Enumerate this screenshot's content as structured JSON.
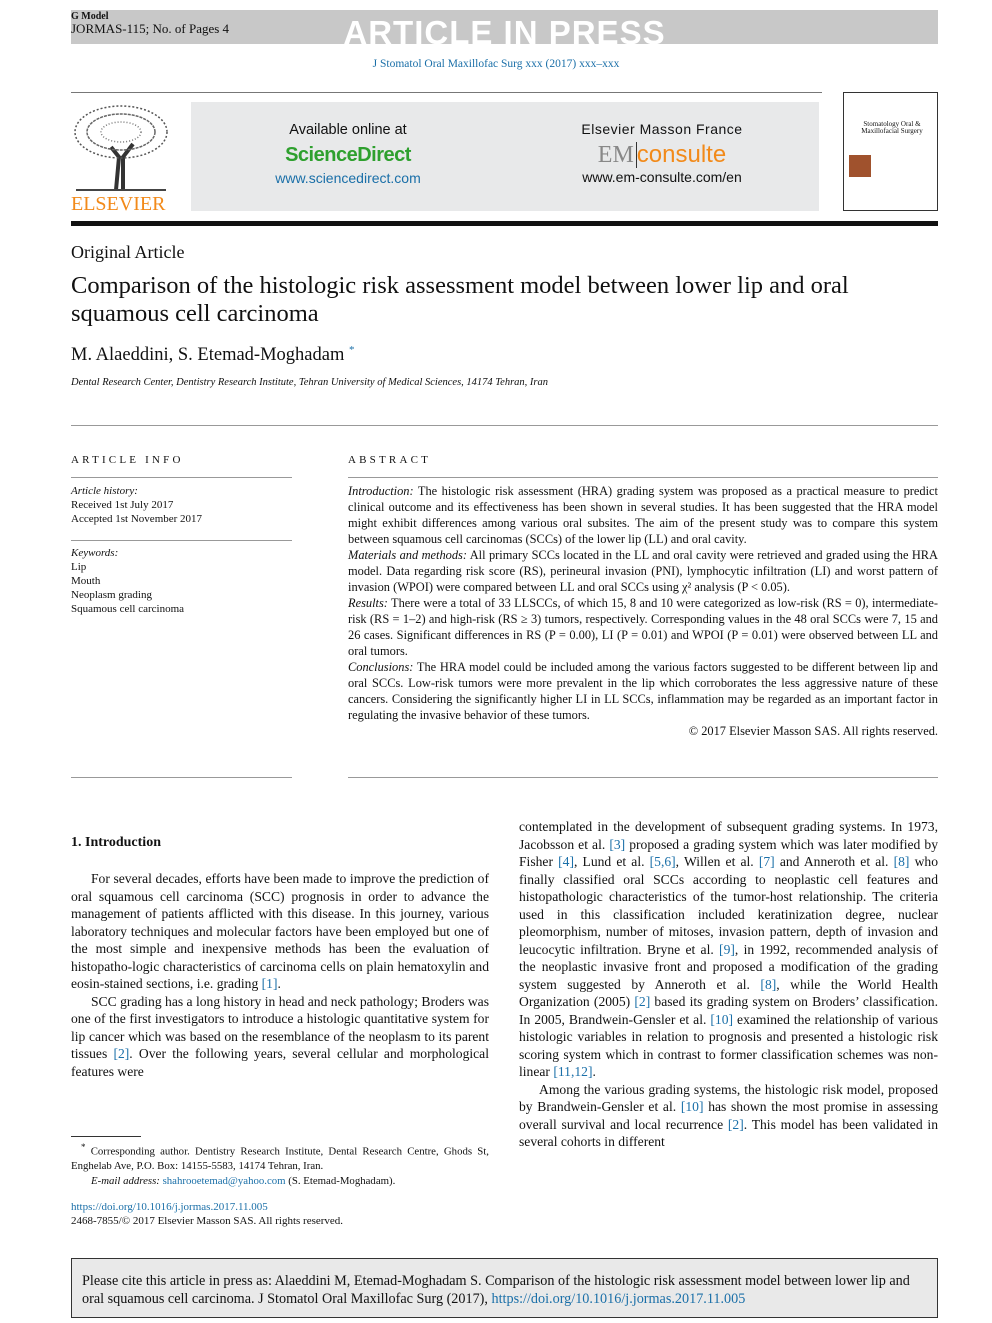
{
  "header": {
    "g_model": "G Model",
    "journal_code": "JORMAS-115; No. of Pages 4",
    "banner": "ARTICLE IN PRESS",
    "journal_ref": "J Stomatol Oral Maxillofac Surg xxx (2017) xxx–xxx"
  },
  "publisher": {
    "logo_text": "ELSEVIER",
    "available": "Available online at",
    "sciencedirect": "ScienceDirect",
    "sd_url": "www.sciencedirect.com",
    "masson": "Elsevier Masson France",
    "em": "EM",
    "consulte": "consulte",
    "em_url": "www.em-consulte.com/en",
    "cover_title": "Stomatology Oral & Maxillofacial Surgery"
  },
  "colors": {
    "link": "#1a6fa8",
    "sciencedirect": "#2ea02e",
    "consulte": "#f28a1a",
    "elsevier": "#f28a1a"
  },
  "article": {
    "type": "Original Article",
    "title": "Comparison of the histologic risk assessment model between lower lip and oral squamous cell carcinoma",
    "authors": "M. Alaeddini, S. Etemad-Moghadam",
    "author_mark": "*",
    "affiliation": "Dental Research Center, Dentistry Research Institute, Tehran University of Medical Sciences, 14174 Tehran, Iran"
  },
  "info": {
    "heading": "ARTICLE INFO",
    "history_label": "Article history:",
    "received": "Received 1st July 2017",
    "accepted": "Accepted 1st November 2017",
    "keywords_label": "Keywords:",
    "keywords": [
      "Lip",
      "Mouth",
      "Neoplasm grading",
      "Squamous cell carcinoma"
    ]
  },
  "abstract": {
    "heading": "ABSTRACT",
    "sections": [
      {
        "label": "Introduction:",
        "text": " The histologic risk assessment (HRA) grading system was proposed as a practical measure to predict clinical outcome and its effectiveness has been shown in several studies. It has been suggested that the HRA model might exhibit differences among various oral subsites. The aim of the present study was to compare this system between squamous cell carcinomas (SCCs) of the lower lip (LL) and oral cavity."
      },
      {
        "label": "Materials and methods:",
        "text": " All primary SCCs located in the LL and oral cavity were retrieved and graded using the HRA model. Data regarding risk score (RS), perineural invasion (PNI), lymphocytic infiltration (LI) and worst pattern of invasion (WPOI) were compared between LL and oral SCCs using χ² analysis (P < 0.05)."
      },
      {
        "label": "Results:",
        "text": " There were a total of 33 LLSCCs, of which 15, 8 and 10 were categorized as low-risk (RS = 0), intermediate-risk (RS = 1–2) and high-risk (RS ≥ 3) tumors, respectively. Corresponding values in the 48 oral SCCs were 7, 15 and 26 cases. Significant differences in RS (P = 0.00), LI (P = 0.01) and WPOI (P = 0.01) were observed between LL and oral tumors."
      },
      {
        "label": "Conclusions:",
        "text": " The HRA model could be included among the various factors suggested to be different between lip and oral SCCs. Low-risk tumors were more prevalent in the lip which corroborates the less aggressive nature of these cancers. Considering the significantly higher LI in LL SCCs, inflammation may be regarded as an important factor in regulating the invasive behavior of these tumors."
      }
    ],
    "copyright": "© 2017 Elsevier Masson SAS. All rights reserved."
  },
  "body": {
    "section_heading": "1.  Introduction",
    "left_paragraphs": [
      [
        [
          "For several decades, efforts have been made to improve the prediction of oral squamous cell carcinoma (SCC) prognosis in order to advance the management of patients afflicted with this disease. In this journey, various laboratory techniques and molecular factors have been employed but one of the most simple and inexpensive methods has been the evaluation of histopatho-logic characteristics of carcinoma cells on plain hematoxylin and eosin-stained sections, i.e. grading ",
          0
        ],
        [
          "[1]",
          1
        ],
        [
          ".",
          0
        ]
      ],
      [
        [
          "SCC grading has a long history in head and neck pathology; Broders was one of the first investigators to introduce a histologic quantitative system for lip cancer which was based on the resemblance of the neoplasm to its parent tissues ",
          0
        ],
        [
          "[2]",
          1
        ],
        [
          ". Over the following years, several cellular and morphological features were",
          0
        ]
      ]
    ],
    "right_paragraphs": [
      [
        [
          "contemplated in the development of subsequent grading systems. In 1973, Jacobsson et al. ",
          0
        ],
        [
          "[3]",
          1
        ],
        [
          " proposed a grading system which was later modified by Fisher ",
          0
        ],
        [
          "[4]",
          1
        ],
        [
          ", Lund et al. ",
          0
        ],
        [
          "[5,6]",
          1
        ],
        [
          ", Willen et al. ",
          0
        ],
        [
          "[7]",
          1
        ],
        [
          " and Anneroth et al. ",
          0
        ],
        [
          "[8]",
          1
        ],
        [
          " who finally classified oral SCCs according to neoplastic cell features and histopathologic characteristics of the tumor-host relationship. The criteria used in this classification included keratinization degree, nuclear pleomorphism, number of mitoses, invasion pattern, depth of invasion and leucocytic infiltration. Bryne et al. ",
          0
        ],
        [
          "[9]",
          1
        ],
        [
          ", in 1992, recommended analysis of the neoplastic invasive front and proposed a modification of the grading system suggested by Anneroth et al. ",
          0
        ],
        [
          "[8]",
          1
        ],
        [
          ", while the World Health Organization (2005) ",
          0
        ],
        [
          "[2]",
          1
        ],
        [
          " based its grading system on Broders’ classification. In 2005, Brandwein-Gensler et al. ",
          0
        ],
        [
          "[10]",
          1
        ],
        [
          " examined the relationship of various histologic variables in relation to prognosis and presented a histologic risk scoring system which in contrast to former classification schemes was non-linear ",
          0
        ],
        [
          "[11,12]",
          1
        ],
        [
          ".",
          0
        ]
      ],
      [
        [
          "Among the various grading systems, the histologic risk model, proposed by Brandwein-Gensler et al. ",
          0
        ],
        [
          "[10]",
          1
        ],
        [
          " has shown the most promise in assessing overall survival and local recurrence ",
          0
        ],
        [
          "[2]",
          1
        ],
        [
          ". This model has been validated in several cohorts in different",
          0
        ]
      ]
    ]
  },
  "footnote": {
    "mark": "*",
    "text": " Corresponding author. Dentistry Research Institute, Dental Research Centre, Ghods St, Enghelab Ave, P.O. Box: 14155-5583, 14174 Tehran, Iran.",
    "email_label": "E-mail address:",
    "email": "shahrooetemad@yahoo.com",
    "email_suffix": " (S. Etemad-Moghadam).",
    "doi": "https://doi.org/10.1016/j.jormas.2017.11.005",
    "issn": "2468-7855/© 2017 Elsevier Masson SAS. All rights reserved."
  },
  "citation": {
    "text": "Please cite this article in press as: Alaeddini  M, Etemad-Moghadam  S. Comparison of the histologic risk assessment model between lower lip and oral squamous cell carcinoma. J Stomatol Oral Maxillofac Surg (2017), ",
    "doi": "https://doi.org/10.1016/j.jormas.2017.11.005"
  }
}
